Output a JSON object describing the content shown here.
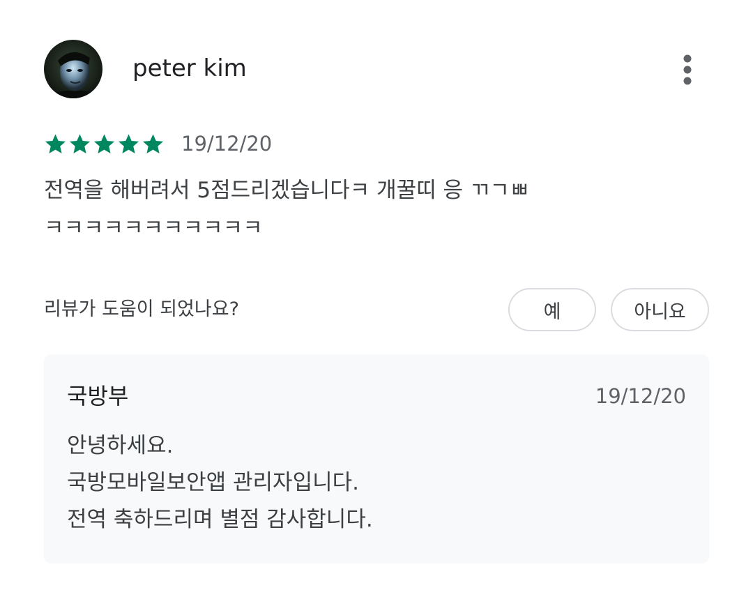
{
  "review": {
    "author": "peter kim",
    "avatar": "user-photo",
    "more_icon": "more-vert-icon",
    "rating": 5,
    "max_rating": 5,
    "star_color": "#01875f",
    "date": "19/12/20",
    "text": "전역을 해버려서 5점드리겠습니다ㅋ 개꿀띠 응 ㄲㄱㅃ\nㅋㅋㅋㅋㅋㅋㅋㅋㅋㅋㅋ"
  },
  "helpful": {
    "question": "리뷰가 도움이 되었나요?",
    "yes_label": "예",
    "no_label": "아니요"
  },
  "developer_reply": {
    "name": "국방부",
    "date": "19/12/20",
    "lines": [
      "안녕하세요.",
      "국방모바일보안앱 관리자입니다.",
      "전역 축하드리며 별점 감사합니다."
    ],
    "background_color": "#f8f9fa"
  }
}
